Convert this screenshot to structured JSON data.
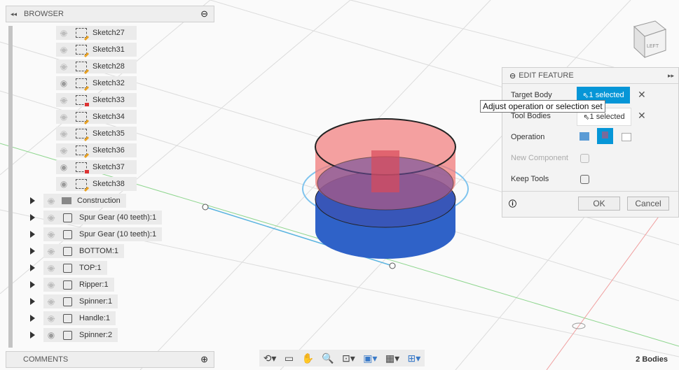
{
  "browser": {
    "title": "BROWSER",
    "sketches": [
      {
        "label": "Sketch27",
        "visible": false,
        "locked": false
      },
      {
        "label": "Sketch31",
        "visible": false,
        "locked": false
      },
      {
        "label": "Sketch28",
        "visible": false,
        "locked": false
      },
      {
        "label": "Sketch32",
        "visible": true,
        "locked": false
      },
      {
        "label": "Sketch33",
        "visible": false,
        "locked": true
      },
      {
        "label": "Sketch34",
        "visible": false,
        "locked": false
      },
      {
        "label": "Sketch35",
        "visible": false,
        "locked": false
      },
      {
        "label": "Sketch36",
        "visible": false,
        "locked": false
      },
      {
        "label": "Sketch37",
        "visible": true,
        "locked": true
      },
      {
        "label": "Sketch38",
        "visible": true,
        "locked": false
      }
    ],
    "items": [
      {
        "label": "Construction",
        "type": "folder",
        "visible": false
      },
      {
        "label": "Spur Gear (40 teeth):1",
        "type": "body",
        "visible": false
      },
      {
        "label": "Spur Gear (10 teeth):1",
        "type": "body",
        "visible": false
      },
      {
        "label": "BOTTOM:1",
        "type": "body",
        "visible": false
      },
      {
        "label": "TOP:1",
        "type": "body",
        "visible": false
      },
      {
        "label": "Ripper:1",
        "type": "body",
        "visible": false
      },
      {
        "label": "Spinner:1",
        "type": "body",
        "visible": false
      },
      {
        "label": "Handle:1",
        "type": "body",
        "visible": false
      },
      {
        "label": "Spinner:2",
        "type": "body",
        "visible": true
      }
    ]
  },
  "comments": {
    "title": "COMMENTS"
  },
  "edit_feature": {
    "title": "EDIT FEATURE",
    "target_body_label": "Target Body",
    "target_body_value": "1 selected",
    "tooltip": "Adjust operation or selection set",
    "tool_bodies_label": "Tool Bodies",
    "tool_bodies_value": "1 selected",
    "operation_label": "Operation",
    "new_component_label": "New Component",
    "keep_tools_label": "Keep Tools",
    "ok": "OK",
    "cancel": "Cancel",
    "accent": "#0696d7"
  },
  "viewcube": {
    "face": "LEFT"
  },
  "status": {
    "bodies": "2 Bodies"
  }
}
